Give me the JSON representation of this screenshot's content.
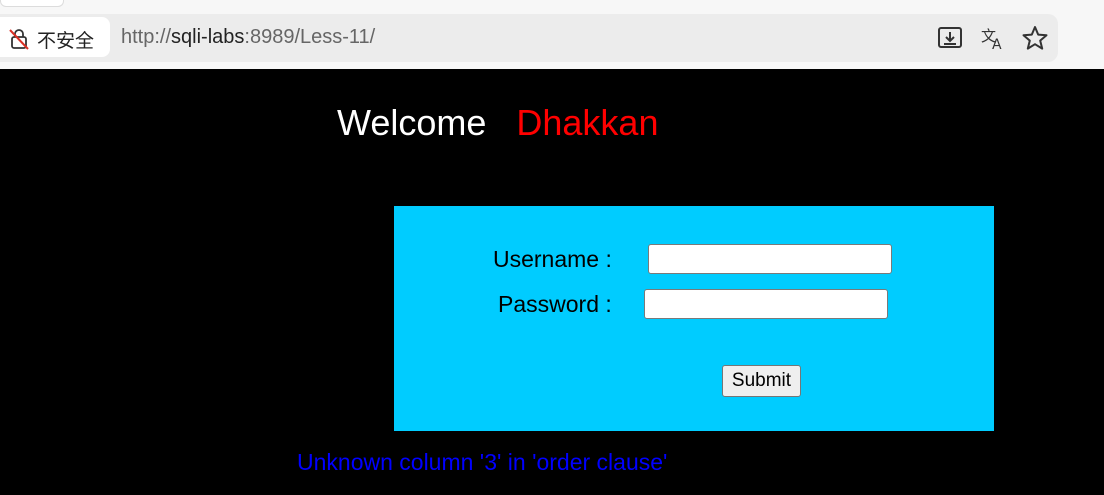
{
  "browser": {
    "security_label": "不安全",
    "url_scheme": "http://",
    "url_host": "sqli-labs",
    "url_rest": ":8989/Less-11/",
    "icons": [
      "lock-slash-icon",
      "install-app-icon",
      "translate-icon",
      "star-bookmark-icon"
    ]
  },
  "page": {
    "welcome": "Welcome",
    "name": "Dhakkan",
    "form": {
      "username_label": "Username :",
      "password_label": "Password :",
      "username_value": "",
      "password_value": "",
      "submit_label": "Submit"
    },
    "error": "Unknown column '3' in 'order clause'",
    "colors": {
      "background": "#000000",
      "form_bg": "#00ccff",
      "name": "#ff0000",
      "error": "#0000ff"
    }
  }
}
